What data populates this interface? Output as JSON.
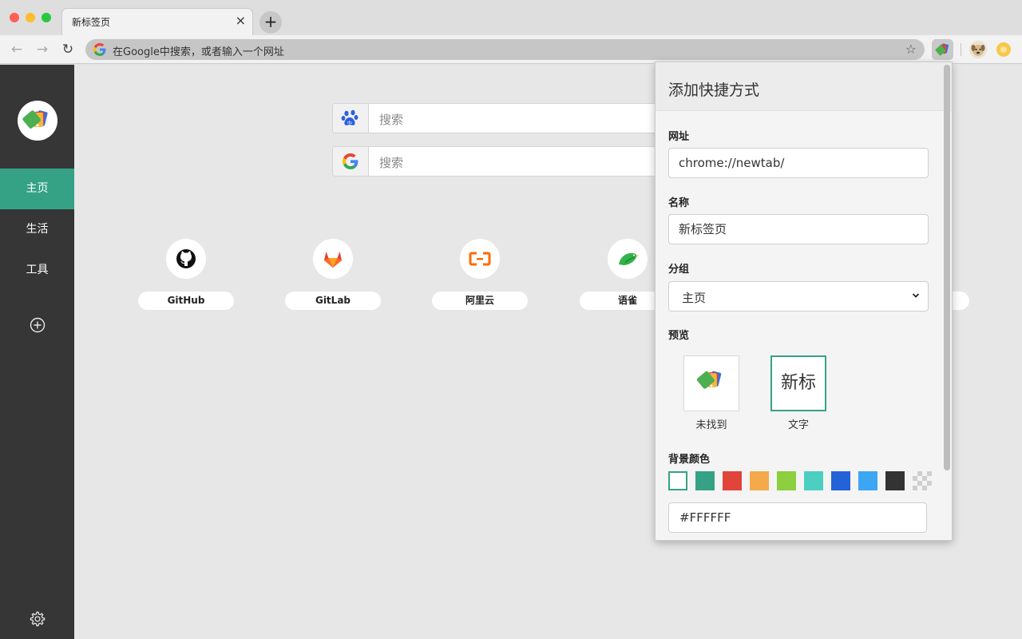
{
  "tab": {
    "title": "新标签页",
    "close": "×",
    "new_tab": "+"
  },
  "toolbar": {
    "back": "←",
    "forward": "→",
    "reload": "↻",
    "omnibox_text": "在Google中搜索，或者输入一个网址",
    "star": "☆"
  },
  "sidebar": {
    "items": [
      {
        "label": "主页",
        "active": true
      },
      {
        "label": "生活",
        "active": false
      },
      {
        "label": "工具",
        "active": false
      }
    ]
  },
  "search": {
    "engines": [
      {
        "engine": "baidu-icon",
        "placeholder": "搜索"
      },
      {
        "engine": "google-icon",
        "placeholder": "搜索"
      }
    ]
  },
  "shortcuts": [
    {
      "label": "GitHub",
      "icon": "github-icon"
    },
    {
      "label": "GitLab",
      "icon": "gitlab-icon"
    },
    {
      "label": "阿里云",
      "icon": "aliyun-icon"
    },
    {
      "label": "语雀",
      "icon": "yuque-icon"
    }
  ],
  "popup": {
    "title": "添加快捷方式",
    "url_label": "网址",
    "url_value": "chrome://newtab/",
    "name_label": "名称",
    "name_value": "新标签页",
    "group_label": "分组",
    "group_value": "主页",
    "preview_label": "预览",
    "preview_image_caption": "未找到",
    "preview_text": "新标",
    "preview_text_caption": "文字",
    "bg_label": "背景颜色",
    "bg_value": "#FFFFFF",
    "swatches": [
      "#FFFFFF",
      "#35A286",
      "#E0443A",
      "#F4A94A",
      "#8CCF3F",
      "#4CCFC0",
      "#2462D8",
      "#3DA6F2",
      "#333333",
      "transparent"
    ]
  },
  "colors": {
    "accent": "#35A286",
    "sidebar_bg": "#363636"
  }
}
